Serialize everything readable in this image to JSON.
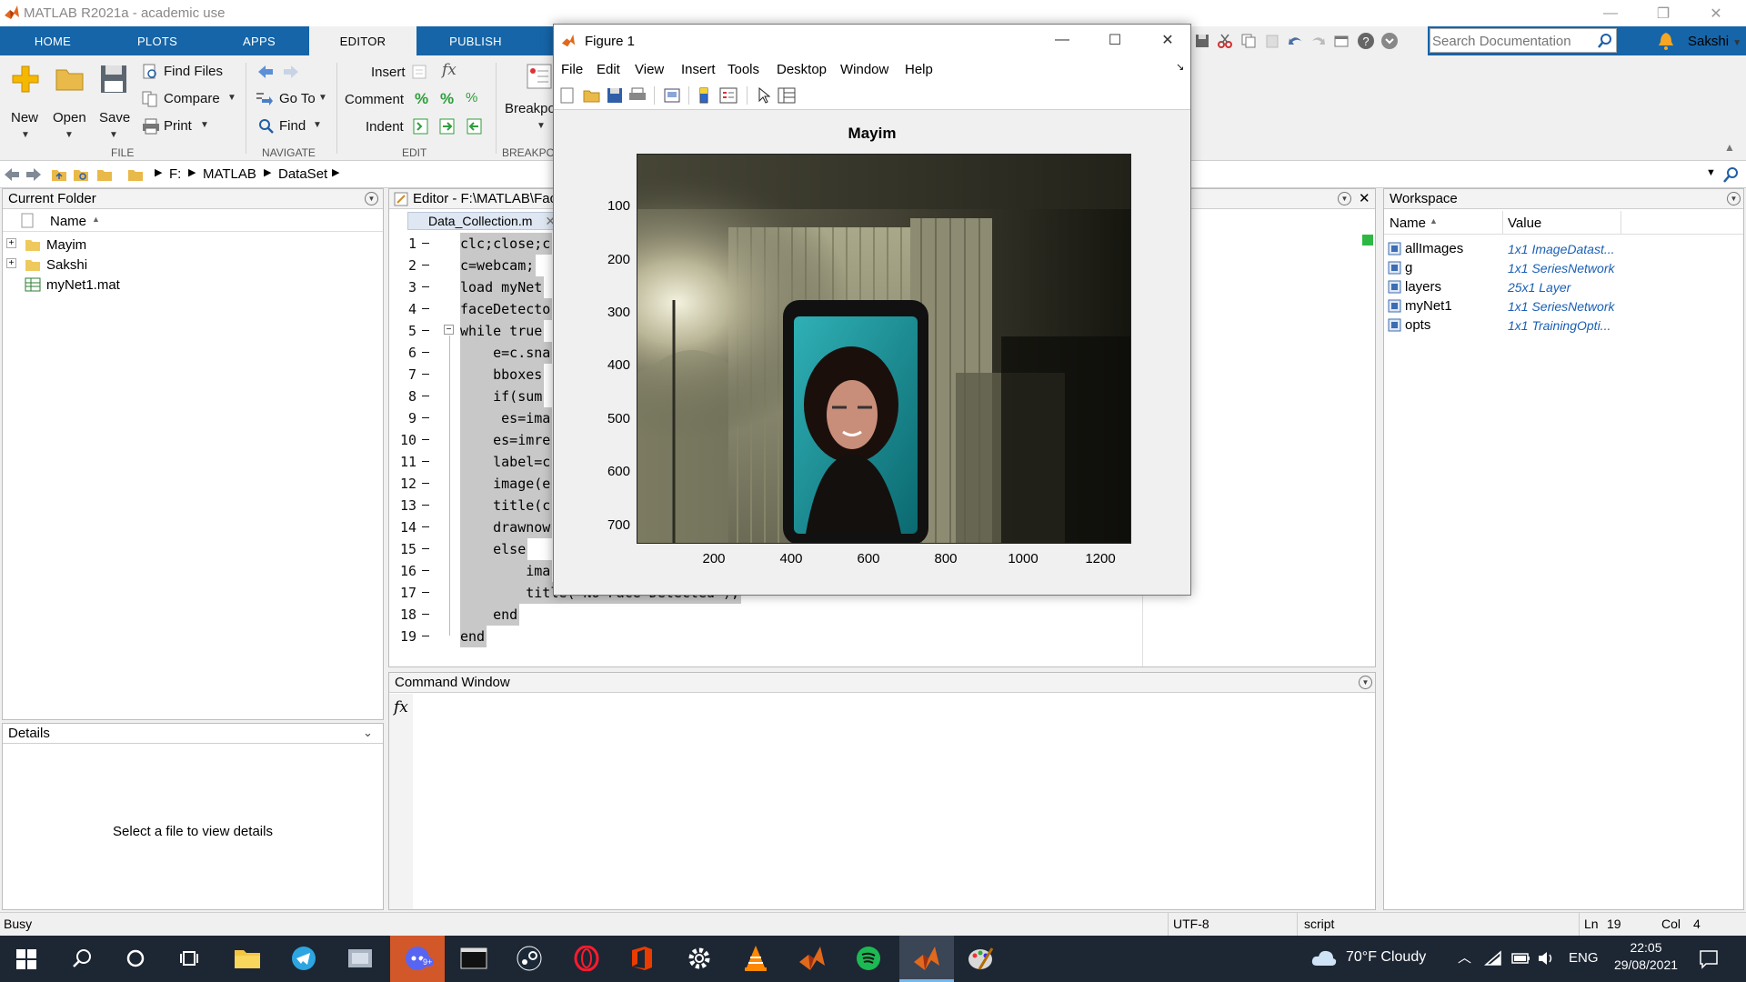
{
  "window": {
    "title": "MATLAB R2021a - academic use"
  },
  "ribbon_tabs": [
    "HOME",
    "PLOTS",
    "APPS",
    "EDITOR",
    "PUBLISH"
  ],
  "ribbon": {
    "new": "New",
    "open": "Open",
    "save": "Save",
    "find_files": "Find Files",
    "compare": "Compare",
    "print": "Print",
    "go_to": "Go To",
    "find": "Find",
    "insert": "Insert",
    "comment": "Comment",
    "indent": "Indent",
    "breakpoints": "Breakpo",
    "group_file": "FILE",
    "group_navigate": "NAVIGATE",
    "group_edit": "EDIT",
    "group_breakpoints": "BREAKPOI",
    "search_placeholder": "Search Documentation",
    "user": "Sakshi"
  },
  "address": {
    "segments": [
      "F:",
      "MATLAB",
      "DataSet"
    ]
  },
  "current_folder": {
    "title": "Current Folder",
    "column_name": "Name",
    "items": [
      {
        "name": "Mayim",
        "type": "folder"
      },
      {
        "name": "Sakshi",
        "type": "folder"
      },
      {
        "name": "myNet1.mat",
        "type": "mat"
      }
    ]
  },
  "details": {
    "title": "Details",
    "message": "Select a file to view details"
  },
  "editor": {
    "title": "Editor - F:\\MATLAB\\Fac",
    "tab": "Data_Collection.m",
    "lines": [
      "clc;close;c",
      "c=webcam;",
      "load myNet",
      "faceDetecto",
      "while true",
      "    e=c.sna",
      "    bboxes",
      "    if(sum",
      "     es=ima",
      "    es=imre",
      "    label=c",
      "    image(e",
      "    title(c",
      "    drawnow",
      "    else",
      "        ima",
      "        title('No Face Detected');",
      "    end",
      "end"
    ]
  },
  "command_window": {
    "title": "Command Window",
    "prompt": "fx"
  },
  "workspace": {
    "title": "Workspace",
    "col_name": "Name",
    "col_value": "Value",
    "vars": [
      {
        "name": "allImages",
        "value": "1x1 ImageDatast..."
      },
      {
        "name": "g",
        "value": "1x1 SeriesNetwork"
      },
      {
        "name": "layers",
        "value": "25x1 Layer"
      },
      {
        "name": "myNet1",
        "value": "1x1 SeriesNetwork"
      },
      {
        "name": "opts",
        "value": "1x1 TrainingOpti..."
      }
    ]
  },
  "figure": {
    "title": "Figure 1",
    "menu": [
      "File",
      "Edit",
      "View",
      "Insert",
      "Tools",
      "Desktop",
      "Window",
      "Help"
    ],
    "axes_title": "Mayim",
    "y_ticks": [
      "100",
      "200",
      "300",
      "400",
      "500",
      "600",
      "700"
    ],
    "x_ticks": [
      "200",
      "400",
      "600",
      "800",
      "1000",
      "1200"
    ]
  },
  "status": {
    "state": "Busy",
    "encoding": "UTF-8",
    "type": "script",
    "ln_label": "Ln",
    "ln": "19",
    "col_label": "Col",
    "col": "4"
  },
  "taskbar": {
    "weather": "70°F  Cloudy",
    "lang": "ENG",
    "time": "22:05",
    "date": "29/08/2021",
    "badge": "9+"
  },
  "colors": {
    "ribbon_blue": "#1565a8",
    "taskbar": "#1d2633",
    "workspace_value": "#1a5fb4",
    "selection": "#c8c8c8"
  }
}
